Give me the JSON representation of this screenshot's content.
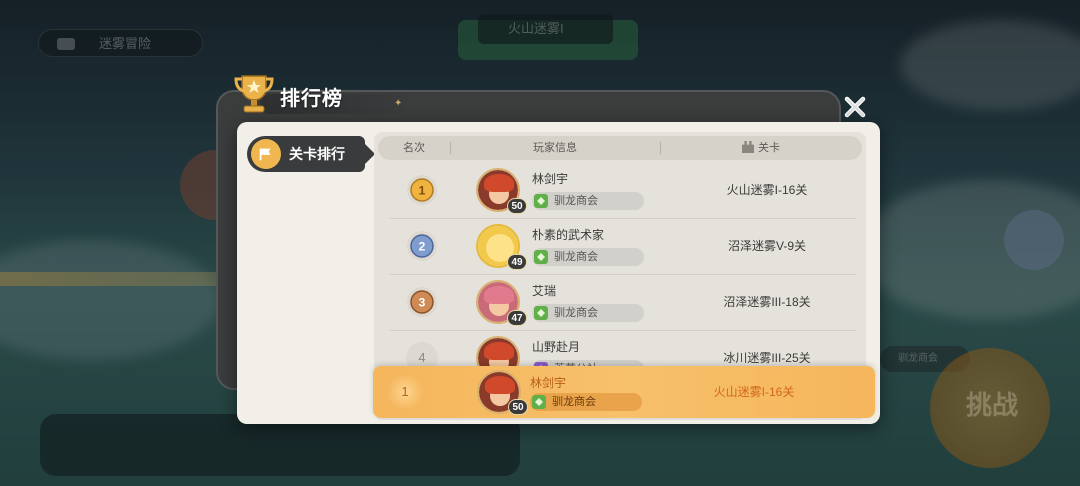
{
  "background": {
    "pill_text": "迷雾冒险",
    "top_badge_text": "火山迷雾I",
    "right_badge_text": "驯龙商会",
    "start_button_text": "挑战"
  },
  "modal": {
    "title": "排行榜",
    "close_label": "✕",
    "tab_label": "关卡排行"
  },
  "table": {
    "headers": {
      "rank": "名次",
      "player": "玩家信息",
      "level": "关卡"
    },
    "rows": [
      {
        "rank": "1",
        "name": "林剑宇",
        "level": "50",
        "guild": "驯龙商会",
        "stage": "火山迷雾I-16关"
      },
      {
        "rank": "2",
        "name": "朴素的武术家",
        "level": "49",
        "guild": "驯龙商会",
        "stage": "沼泽迷雾V-9关"
      },
      {
        "rank": "3",
        "name": "艾瑞",
        "level": "47",
        "guild": "驯龙商会",
        "stage": "沼泽迷雾III-18关"
      },
      {
        "rank": "4",
        "name": "山野赴月",
        "level": "",
        "guild": "莱茵公社",
        "stage": "冰川迷雾III-25关"
      }
    ]
  },
  "self": {
    "rank": "1",
    "name": "林剑宇",
    "level": "50",
    "guild": "驯龙商会",
    "stage": "火山迷雾I-16关"
  },
  "colors": {
    "accent": "#f5b65c",
    "panel": "#f2efe8",
    "gold_medal": "#f0b340",
    "silver_medal": "#7f9ccf",
    "bronze_medal": "#d08a55"
  }
}
